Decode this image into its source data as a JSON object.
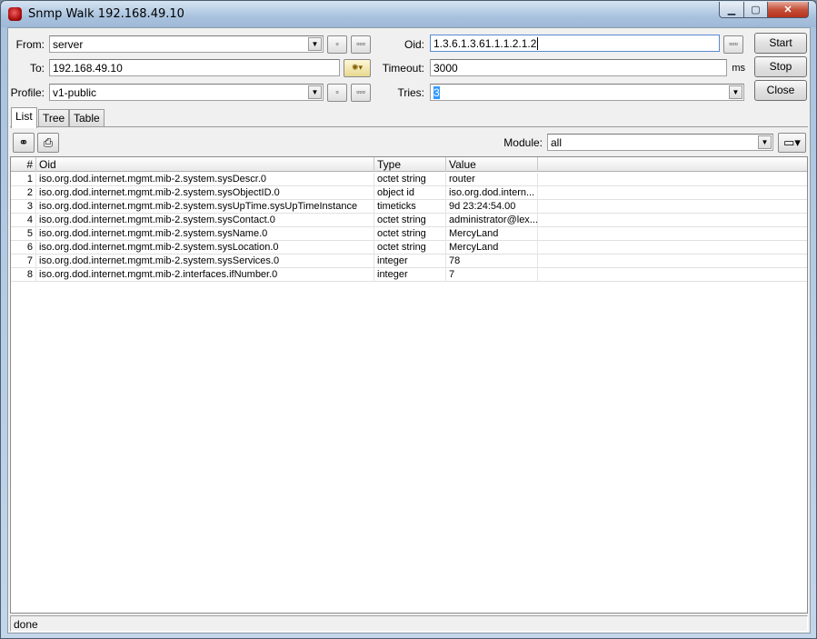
{
  "window": {
    "title": "Snmp Walk 192.168.49.10",
    "icons": {
      "app": "mikrotik-app-icon",
      "minimize": "minimize-icon",
      "maximize": "maximize-icon",
      "close": "close-icon"
    }
  },
  "form": {
    "from_label": "From:",
    "from_value": "server",
    "to_label": "To:",
    "to_value": "192.168.49.10",
    "profile_label": "Profile:",
    "profile_value": "v1-public",
    "oid_label": "Oid:",
    "oid_value": "1.3.6.1.3.61.1.1.2.1.2",
    "timeout_label": "Timeout:",
    "timeout_value": "3000",
    "timeout_unit": "ms",
    "tries_label": "Tries:",
    "tries_value": "3",
    "small_btn": "▫",
    "dots_btn": "▫▫▫"
  },
  "buttons": {
    "start": "Start",
    "stop": "Stop",
    "close": "Close"
  },
  "tabs": [
    {
      "label": "List",
      "active": true
    },
    {
      "label": "Tree",
      "active": false
    },
    {
      "label": "Table",
      "active": false
    }
  ],
  "toolbar": {
    "find_icon": "binoculars-icon",
    "print_icon": "printer-icon",
    "module_label": "Module:",
    "module_value": "all",
    "columns_icon": "window-columns-icon"
  },
  "table": {
    "headers": {
      "num": "#",
      "oid": "Oid",
      "type": "Type",
      "value": "Value"
    },
    "rows": [
      {
        "num": "1",
        "oid": "iso.org.dod.internet.mgmt.mib-2.system.sysDescr.0",
        "type": "octet string",
        "value": "router"
      },
      {
        "num": "2",
        "oid": "iso.org.dod.internet.mgmt.mib-2.system.sysObjectID.0",
        "type": "object id",
        "value": "iso.org.dod.intern..."
      },
      {
        "num": "3",
        "oid": "iso.org.dod.internet.mgmt.mib-2.system.sysUpTime.sysUpTimeInstance",
        "type": "timeticks",
        "value": "9d 23:24:54.00"
      },
      {
        "num": "4",
        "oid": "iso.org.dod.internet.mgmt.mib-2.system.sysContact.0",
        "type": "octet string",
        "value": "administrator@lex..."
      },
      {
        "num": "5",
        "oid": "iso.org.dod.internet.mgmt.mib-2.system.sysName.0",
        "type": "octet string",
        "value": "MercyLand"
      },
      {
        "num": "6",
        "oid": "iso.org.dod.internet.mgmt.mib-2.system.sysLocation.0",
        "type": "octet string",
        "value": "MercyLand"
      },
      {
        "num": "7",
        "oid": "iso.org.dod.internet.mgmt.mib-2.system.sysServices.0",
        "type": "integer",
        "value": "78"
      },
      {
        "num": "8",
        "oid": "iso.org.dod.internet.mgmt.mib-2.interfaces.ifNumber.0",
        "type": "integer",
        "value": "7"
      }
    ]
  },
  "status": {
    "text": "done"
  }
}
